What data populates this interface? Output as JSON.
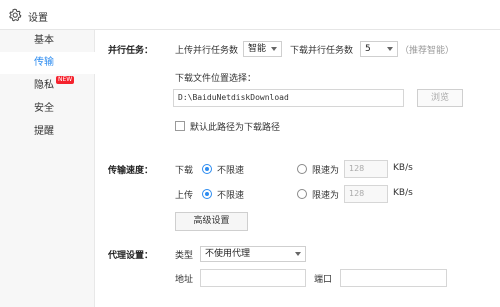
{
  "window": {
    "title": "设置"
  },
  "sidebar": {
    "items": [
      {
        "label": "基本"
      },
      {
        "label": "传输",
        "active": true
      },
      {
        "label": "隐私",
        "badge": "NEW"
      },
      {
        "label": "安全"
      },
      {
        "label": "提醒"
      }
    ]
  },
  "parallel": {
    "section_label": "并行任务：",
    "upload_label": "上传并行任务数",
    "upload_value": "智能",
    "download_label": "下载并行任务数",
    "download_value": "5",
    "hint": "（推荐智能）"
  },
  "download_location": {
    "label": "下载文件位置选择：",
    "path": "D:\\BaiduNetdiskDownload",
    "browse_label": "浏览",
    "default_checkbox_label": "默认此路径为下载路径",
    "default_checked": false
  },
  "speed": {
    "section_label": "传输速度：",
    "download": {
      "label": "下载",
      "unlimited_label": "不限速",
      "limit_label": "限速为",
      "limit_value": "128",
      "unit": "KB/s",
      "mode": "unlimited"
    },
    "upload": {
      "label": "上传",
      "unlimited_label": "不限速",
      "limit_label": "限速为",
      "limit_value": "128",
      "unit": "KB/s",
      "mode": "unlimited"
    },
    "advanced_label": "高级设置"
  },
  "proxy": {
    "section_label": "代理设置：",
    "type_label": "类型",
    "type_value": "不使用代理",
    "address_label": "地址",
    "address_value": "",
    "port_label": "端口",
    "port_value": ""
  },
  "colors": {
    "accent": "#2d8cf0",
    "badge": "#f5222d"
  }
}
